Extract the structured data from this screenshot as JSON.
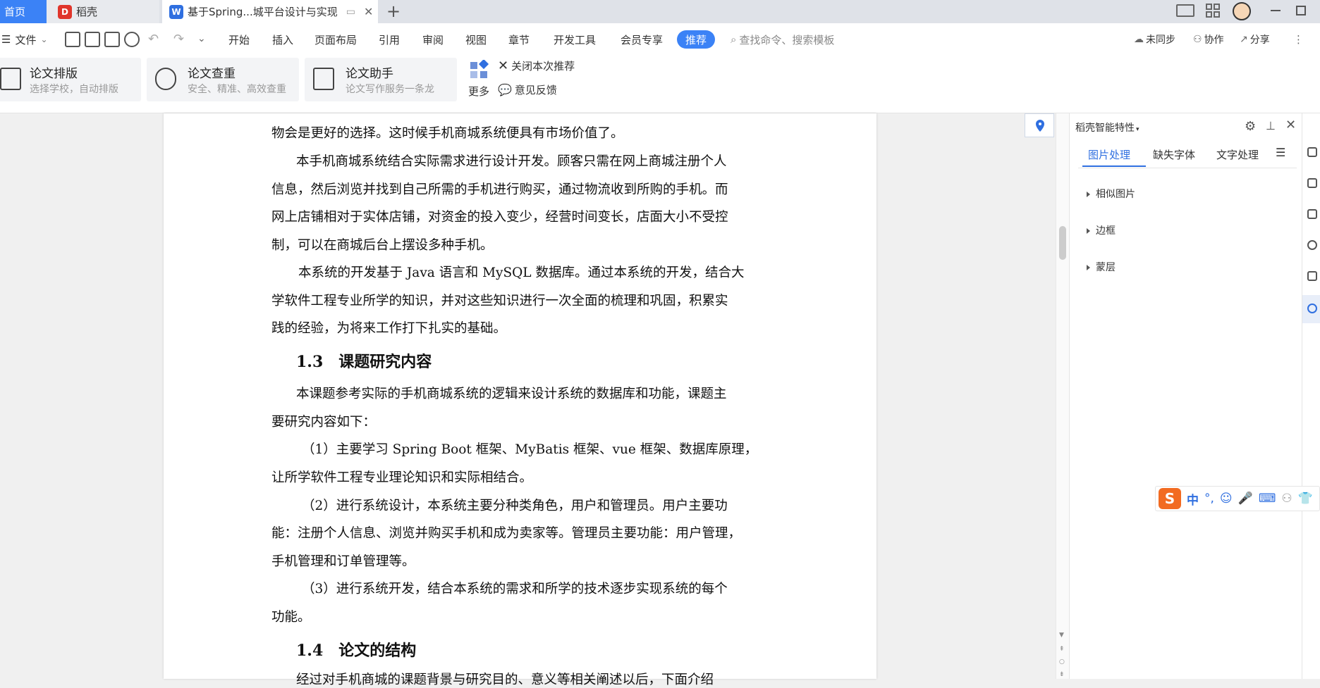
{
  "tabs": {
    "home": "首页",
    "daoke": "稻壳",
    "doc": "基于Spring...城平台设计与实现",
    "new_tab": "+"
  },
  "menubar": {
    "file": "文件",
    "items": [
      "开始",
      "插入",
      "页面布局",
      "引用",
      "审阅",
      "视图",
      "章节",
      "开发工具",
      "会员专享"
    ],
    "recommend": "推荐",
    "search_placeholder": "查找命令、搜索模板",
    "unsynced": "未同步",
    "collab": "协作",
    "share": "分享"
  },
  "ribbon": {
    "cards": [
      {
        "title": "论文排版",
        "sub": "选择学校，自动排版"
      },
      {
        "title": "论文查重",
        "sub": "安全、精准、高效查重"
      },
      {
        "title": "论文助手",
        "sub": "论文写作服务一条龙"
      }
    ],
    "more": "更多",
    "close_recommend": "关闭本次推荐",
    "feedback": "意见反馈"
  },
  "document": {
    "lines": [
      "物会是更好的选择。这时候手机商城系统便具有市场价值了。",
      "本手机商城系统结合实际需求进行设计开发。顾客只需在网上商城注册个人",
      "信息，然后浏览并找到自己所需的手机进行购买，通过物流收到所购的手机。而",
      "网上店铺相对于实体店铺，对资金的投入变少，经营时间变长，店面大小不受控",
      "制，可以在商城后台上摆设多种手机。",
      "本系统的开发基于 Java 语言和 MySQL 数据库。通过本系统的开发，结合大",
      "学软件工程专业所学的知识，并对这些知识进行一次全面的梳理和巩固，积累实",
      "践的经验，为将来工作打下扎实的基础。",
      "本课题参考实际的手机商城系统的逻辑来设计系统的数据库和功能，课题主",
      "要研究内容如下：",
      "（1）主要学习 Spring Boot 框架、MyBatis 框架、vue 框架、数据库原理，",
      "让所学软件工程专业理论知识和实际相结合。",
      "（2）进行系统设计，本系统主要分种类角色，用户和管理员。用户主要功",
      "能：注册个人信息、浏览并购买手机和成为卖家等。管理员主要功能：用户管理，",
      "手机管理和订单管理等。",
      "（3）进行系统开发，结合本系统的需求和所学的技术逐步实现系统的每个",
      "功能。",
      "经过对手机商城的课题背景与研究目的、意义等相关阐述以后，下面介绍"
    ],
    "heading_1_3_num": "1.3",
    "heading_1_3_text": "课题研究内容",
    "heading_1_4_num": "1.4",
    "heading_1_4_text": "论文的结构"
  },
  "sidepanel": {
    "title": "稻壳智能特性",
    "tabs": [
      "图片处理",
      "缺失字体",
      "文字处理"
    ],
    "items": [
      "相似图片",
      "边框",
      "蒙层"
    ]
  },
  "ime": {
    "mode": "中",
    "punct": "°,"
  },
  "colors": {
    "accent": "#3b82f6",
    "tab_active_text": "#2f6fe0",
    "ime_orange": "#f26b22"
  }
}
